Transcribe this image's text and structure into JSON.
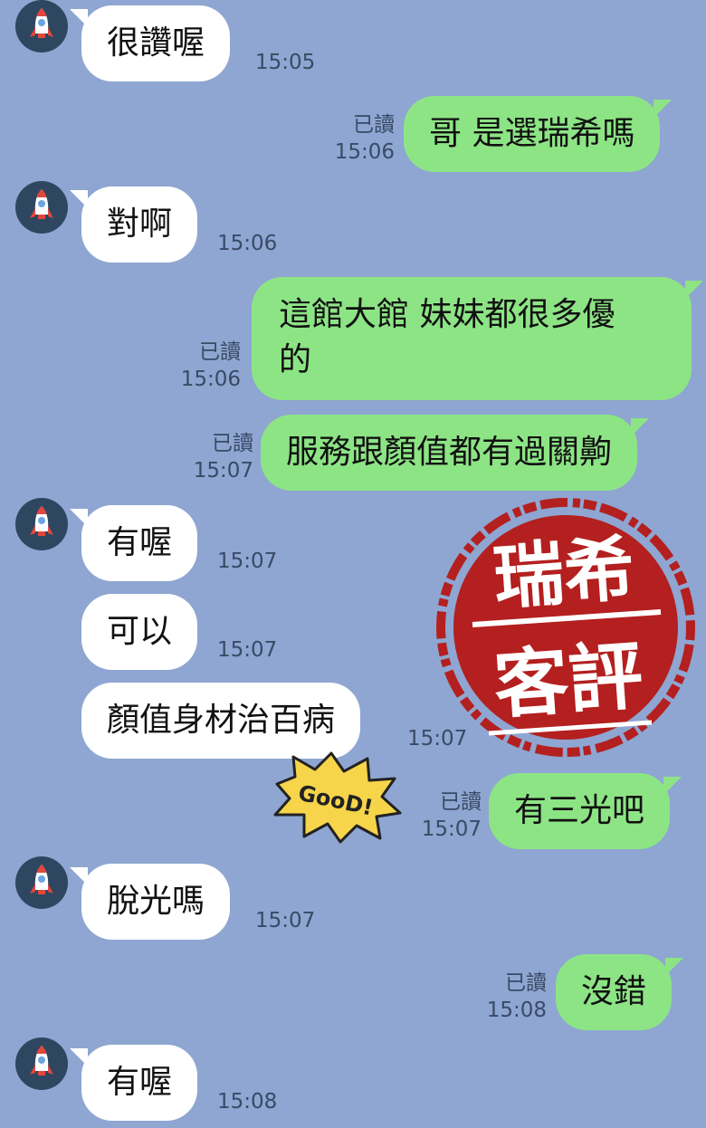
{
  "messages": [
    {
      "id": "m1",
      "side": "in",
      "text": "很讚喔",
      "time": "15:05"
    },
    {
      "id": "m2",
      "side": "out",
      "text": "哥 是選瑞希嗎",
      "read": "已讀",
      "time": "15:06"
    },
    {
      "id": "m3",
      "side": "in",
      "text": "對啊",
      "time": "15:06"
    },
    {
      "id": "m4",
      "side": "out",
      "line1": "這館大館 妹妹都很多優",
      "line2": "的",
      "read": "已讀",
      "time": "15:06"
    },
    {
      "id": "m5",
      "side": "out",
      "text": "服務跟顏值都有過關齁",
      "read": "已讀",
      "time": "15:07"
    },
    {
      "id": "m6",
      "side": "in",
      "text": "有喔",
      "time": "15:07"
    },
    {
      "id": "m7",
      "side": "in",
      "text": "可以",
      "time": "15:07"
    },
    {
      "id": "m8",
      "side": "in",
      "text": "顏值身材治百病",
      "time": "15:07"
    },
    {
      "id": "m9",
      "side": "out",
      "text": "有三光吧",
      "read": "已讀",
      "time": "15:07"
    },
    {
      "id": "m10",
      "side": "in",
      "text": "脫光嗎",
      "time": "15:07"
    },
    {
      "id": "m11",
      "side": "out",
      "text": "沒錯",
      "read": "已讀",
      "time": "15:08"
    },
    {
      "id": "m12",
      "side": "in",
      "text": "有喔",
      "time": "15:08"
    }
  ],
  "stamp": {
    "line1": "瑞希",
    "line2": "客評",
    "color": "#b3201f"
  },
  "sticker": {
    "text": "GooD!"
  },
  "colors": {
    "background": "#8ea6d1",
    "bubble_in": "#ffffff",
    "bubble_out": "#8de485",
    "avatar": "#2f4660"
  },
  "avatar_icon": "rocket-icon"
}
